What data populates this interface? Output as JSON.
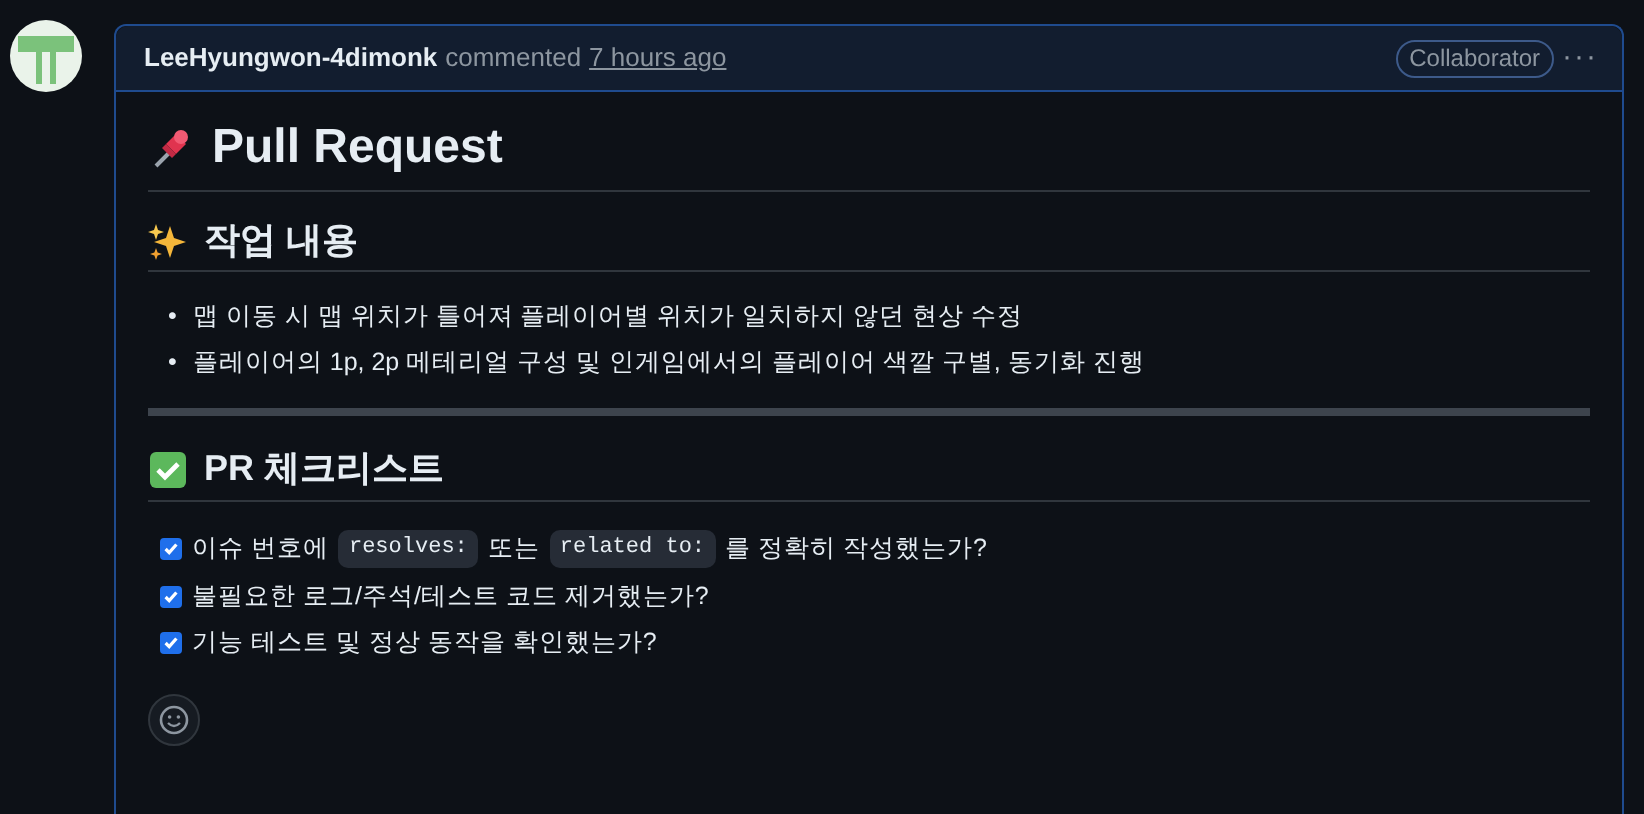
{
  "comment": {
    "author": "LeeHyungwon-4dimonk",
    "action": "commented",
    "time": "7 hours ago",
    "role": "Collaborator",
    "menu": "···"
  },
  "title": "Pull Request",
  "sections": [
    {
      "kind": "list",
      "heading": "작업 내용",
      "items": [
        {
          "marker": "•",
          "text": "맵 이동 시 맵 위치가 틀어져 플레이어별 위치가 일치하지 않던 현상 수정"
        },
        {
          "marker": "•",
          "text": "플레이어의 1p, 2p 메테리얼 구성 및 인게임에서의 플레이어 색깔 구별, 동기화 진행"
        }
      ]
    },
    {
      "kind": "checklist",
      "heading": "PR 체크리스트",
      "items": [
        {
          "checked": true,
          "parts": [
            {
              "kind": "text",
              "text": "이슈 번호에"
            },
            {
              "kind": "code",
              "text": "resolves:"
            },
            {
              "kind": "text",
              "text": "또는"
            },
            {
              "kind": "code",
              "text": "related to:"
            },
            {
              "kind": "text",
              "text": "를 정확히 작성했는가?"
            }
          ]
        },
        {
          "checked": true,
          "parts": [
            {
              "kind": "text",
              "text": "불필요한 로그/주석/테스트 코드 제거했는가?"
            }
          ]
        },
        {
          "checked": true,
          "parts": [
            {
              "kind": "text",
              "text": "기능 테스트 및 정상 동작을 확인했는가?"
            }
          ]
        }
      ]
    }
  ]
}
